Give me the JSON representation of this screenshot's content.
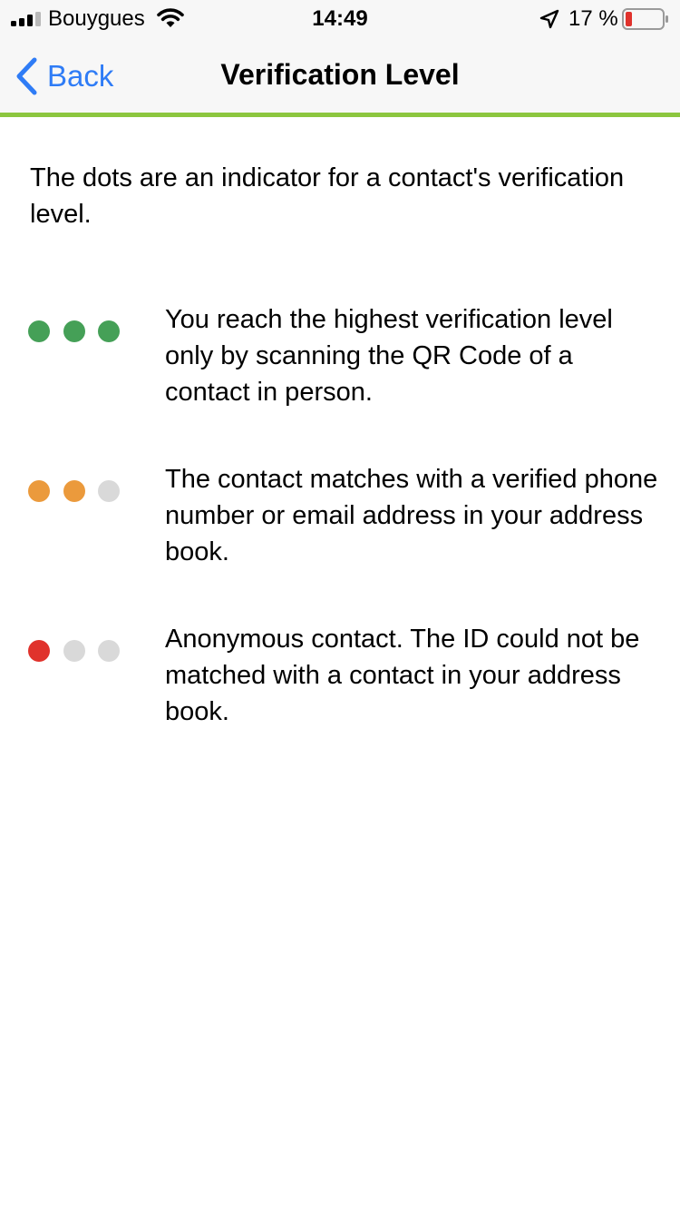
{
  "status_bar": {
    "carrier": "Bouygues",
    "time": "14:49",
    "battery_percent": "17 %",
    "battery_level": 0.17,
    "signal_bars_filled": 3,
    "signal_bars_total": 4
  },
  "nav": {
    "back_label": "Back",
    "title": "Verification Level",
    "accent_color": "#8cc63f",
    "back_color": "#2f7cf6"
  },
  "intro": "The dots are an indicator for a contact's verification level.",
  "colors": {
    "green": "#45a057",
    "orange": "#eb9a3c",
    "red": "#e0322c",
    "gray": "#d9d9d9"
  },
  "levels": [
    {
      "dots": [
        "green",
        "green",
        "green"
      ],
      "text": "You reach the highest verification level only by scanning the QR Code of a contact in person."
    },
    {
      "dots": [
        "orange",
        "orange",
        "gray"
      ],
      "text": "The contact matches with a verified phone number or email address in your address book."
    },
    {
      "dots": [
        "red",
        "gray",
        "gray"
      ],
      "text": "Anonymous contact. The ID could not be matched with a contact in your address book."
    }
  ]
}
